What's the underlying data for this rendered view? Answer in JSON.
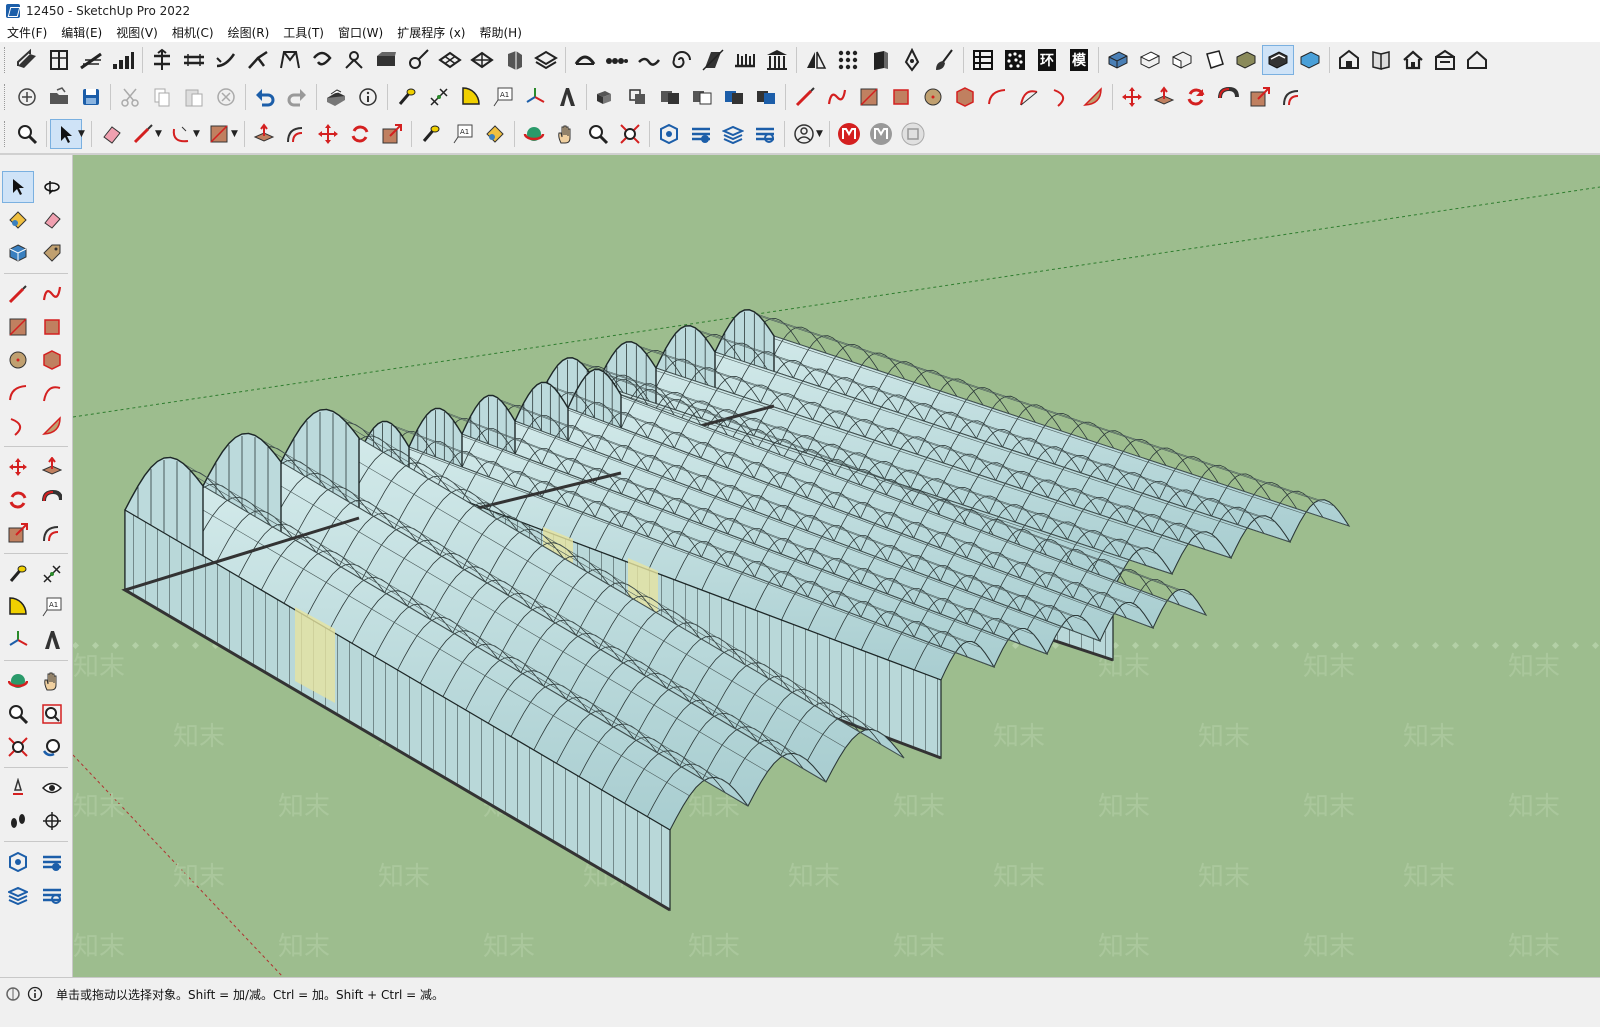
{
  "window": {
    "title": "12450 - SketchUp Pro 2022"
  },
  "menubar": {
    "items": [
      "文件(F)",
      "编辑(E)",
      "视图(V)",
      "相机(C)",
      "绘图(R)",
      "工具(T)",
      "窗口(W)",
      "扩展程序 (x)",
      "帮助(H)"
    ]
  },
  "toolbar_labels": {
    "component_browser": "环",
    "model_info": "模"
  },
  "statusbar": {
    "hint": "单击或拖动以选择对象。Shift = 加/减。Ctrl = 加。Shift + Ctrl = 减。"
  },
  "watermark": {
    "text": "知末"
  },
  "colors": {
    "ground": "#9dbd8e",
    "glass": "#c2dedf",
    "glass_dark": "#a9cdd0",
    "accent_red": "#d42020",
    "accent_blue": "#1c5ea9"
  }
}
